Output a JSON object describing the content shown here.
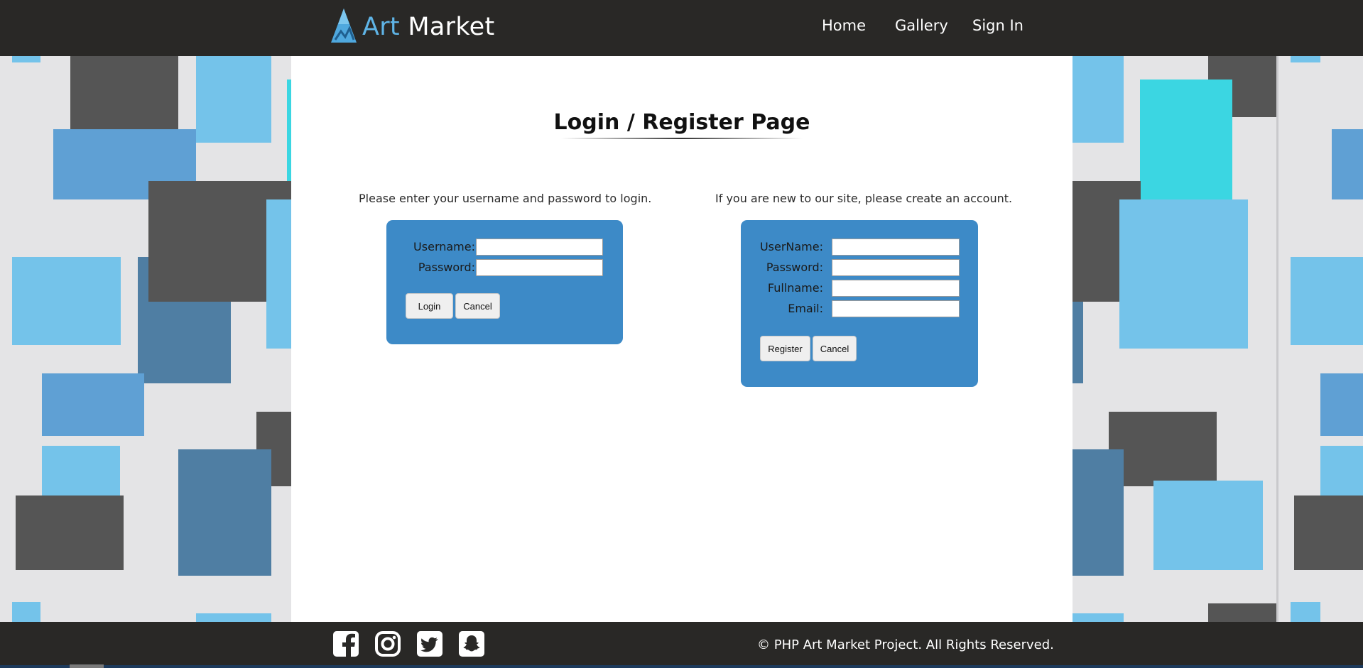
{
  "brand": {
    "name_part1": "Art",
    "name_part2": "Market"
  },
  "nav": {
    "items": [
      {
        "label": "Home"
      },
      {
        "label": "Gallery"
      },
      {
        "label": "Sign In"
      }
    ]
  },
  "page": {
    "title": "Login / Register Page"
  },
  "login": {
    "intro": "Please enter your username and password to login.",
    "username_label": "Username:",
    "password_label": "Password:",
    "username_value": "",
    "password_value": "",
    "submit_label": "Login",
    "cancel_label": "Cancel"
  },
  "register": {
    "intro": "If you are new to our site, please create an account.",
    "username_label": "UserName:",
    "password_label": "Password:",
    "fullname_label": "Fullname:",
    "email_label": "Email:",
    "submit_label": "Register",
    "cancel_label": "Cancel"
  },
  "footer": {
    "copyright": "© PHP Art Market Project. All Rights Reserved.",
    "social_icons": [
      "facebook-icon",
      "instagram-icon",
      "twitter-icon",
      "snapchat-icon"
    ]
  },
  "colors": {
    "header_bg": "#292826",
    "accent_blue": "#3d8ac7",
    "logo_blue": "#5fb4e6",
    "panel_bg": "#ffffff"
  }
}
